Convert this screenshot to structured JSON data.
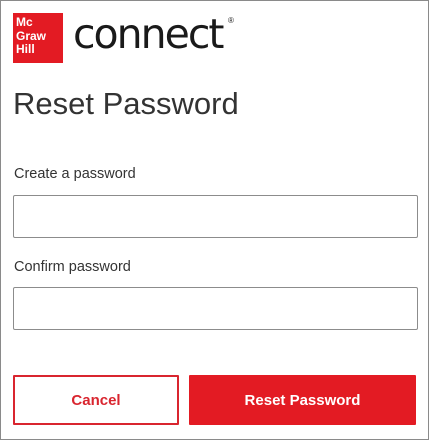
{
  "brand": {
    "logo_lines": [
      "Mc",
      "Graw",
      "Hill"
    ],
    "product_name": "connect",
    "registered_mark": "®",
    "color": "#e31b23"
  },
  "page": {
    "title": "Reset Password"
  },
  "form": {
    "create_label": "Create a password",
    "create_value": "",
    "confirm_label": "Confirm password",
    "confirm_value": ""
  },
  "actions": {
    "cancel_label": "Cancel",
    "reset_label": "Reset Password"
  }
}
